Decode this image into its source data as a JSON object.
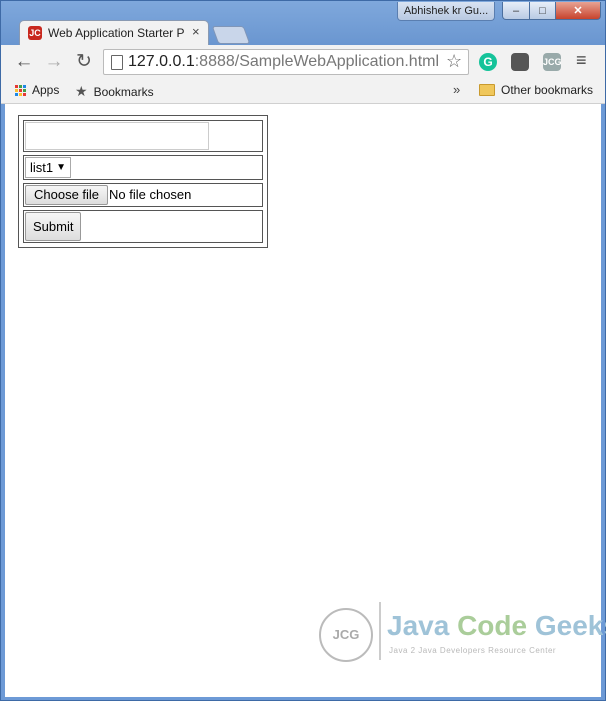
{
  "window": {
    "user_badge": "Abhishek kr Gu...",
    "min_symbol": "–",
    "max_symbol": "□",
    "close_symbol": "✕"
  },
  "tab": {
    "favicon": "JC",
    "title": "Web Application Starter P",
    "close": "×"
  },
  "toolbar": {
    "back": "←",
    "forward": "→",
    "reload": "↻",
    "url_host": "127.0.0.1",
    "url_rest": ":8888/SampleWebApplication.html",
    "star": "☆",
    "ext_grammarly": "G",
    "ext_pocket": "",
    "ext_jcg": "JCG",
    "menu": "≡"
  },
  "bookmarks": {
    "apps": "Apps",
    "bookmarks": "Bookmarks",
    "chevron": "»",
    "other": "Other bookmarks"
  },
  "form": {
    "text_value": "",
    "list_selected": "list1",
    "list_arrow": "▼",
    "choose_file": "Choose file",
    "file_status": "No file chosen",
    "submit": "Submit"
  },
  "watermark": {
    "logo_text": "JCG",
    "title_part1": "Java ",
    "title_part2": "Code ",
    "title_part3": "Geeks",
    "subtitle": "Java 2 Java Developers Resource Center"
  }
}
